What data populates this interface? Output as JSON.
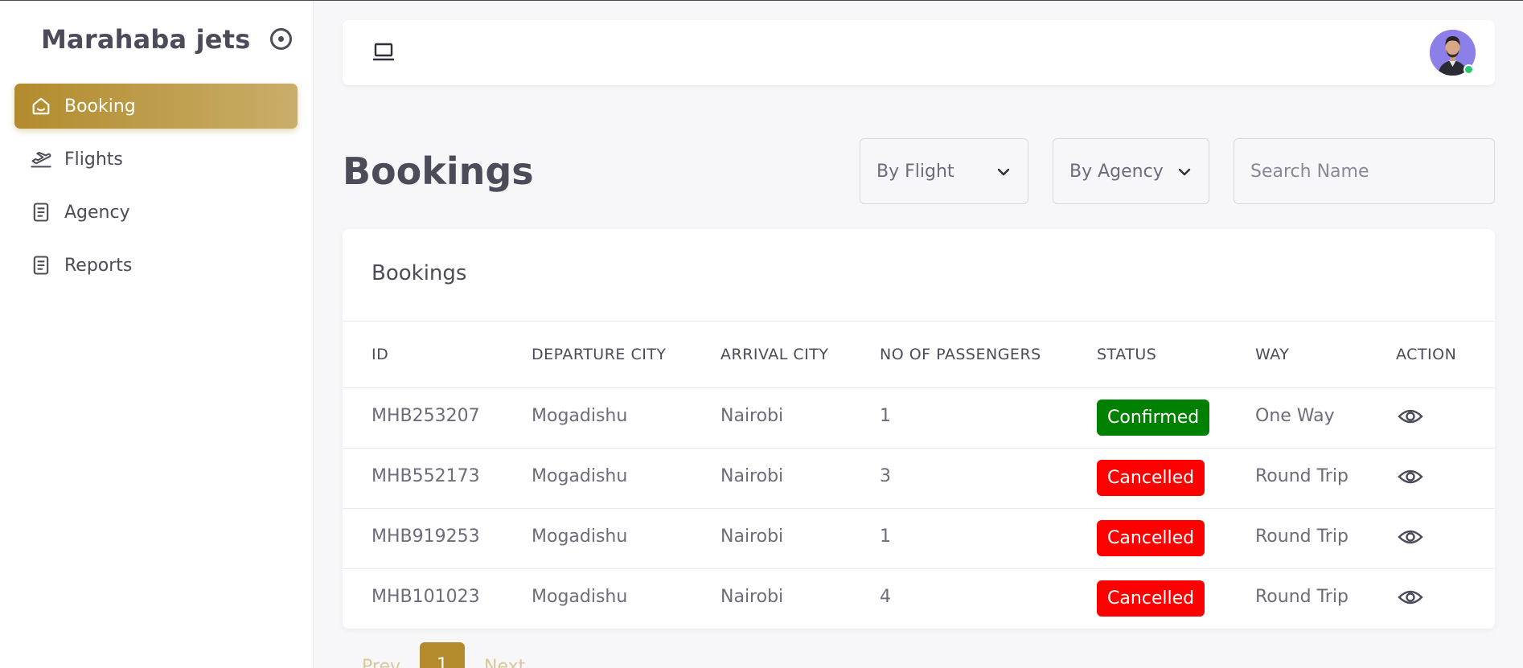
{
  "sidebar": {
    "brand": "Marahaba jets",
    "items": [
      {
        "label": "Booking",
        "icon": "home-icon",
        "active": true
      },
      {
        "label": "Flights",
        "icon": "plane-departure-icon",
        "active": false
      },
      {
        "label": "Agency",
        "icon": "document-icon",
        "active": false
      },
      {
        "label": "Reports",
        "icon": "document-icon",
        "active": false
      }
    ]
  },
  "topbar": {
    "left_icon": "laptop-icon",
    "user_status": "online"
  },
  "page": {
    "title": "Bookings",
    "filters": {
      "by_flight": "By Flight",
      "by_agency": "By Agency",
      "search_placeholder": "Search Name"
    }
  },
  "card": {
    "title": "Bookings",
    "columns": [
      "ID",
      "DEPARTURE CITY",
      "ARRIVAL CITY",
      "NO OF PASSENGERS",
      "STATUS",
      "WAY",
      "ACTION"
    ],
    "rows": [
      {
        "id": "MHB253207",
        "departure": "Mogadishu",
        "arrival": "Nairobi",
        "passengers": "1",
        "status": "Confirmed",
        "way": "One Way"
      },
      {
        "id": "MHB552173",
        "departure": "Mogadishu",
        "arrival": "Nairobi",
        "passengers": "3",
        "status": "Cancelled",
        "way": "Round Trip"
      },
      {
        "id": "MHB919253",
        "departure": "Mogadishu",
        "arrival": "Nairobi",
        "passengers": "1",
        "status": "Cancelled",
        "way": "Round Trip"
      },
      {
        "id": "MHB101023",
        "departure": "Mogadishu",
        "arrival": "Nairobi",
        "passengers": "4",
        "status": "Cancelled",
        "way": "Round Trip"
      }
    ]
  },
  "pagination": {
    "prev": "Prev",
    "current": "1",
    "next": "Next"
  },
  "colors": {
    "accent": "#b28b2d",
    "confirmed": "#008000",
    "cancelled": "#ff0000",
    "online": "#28c76f"
  }
}
